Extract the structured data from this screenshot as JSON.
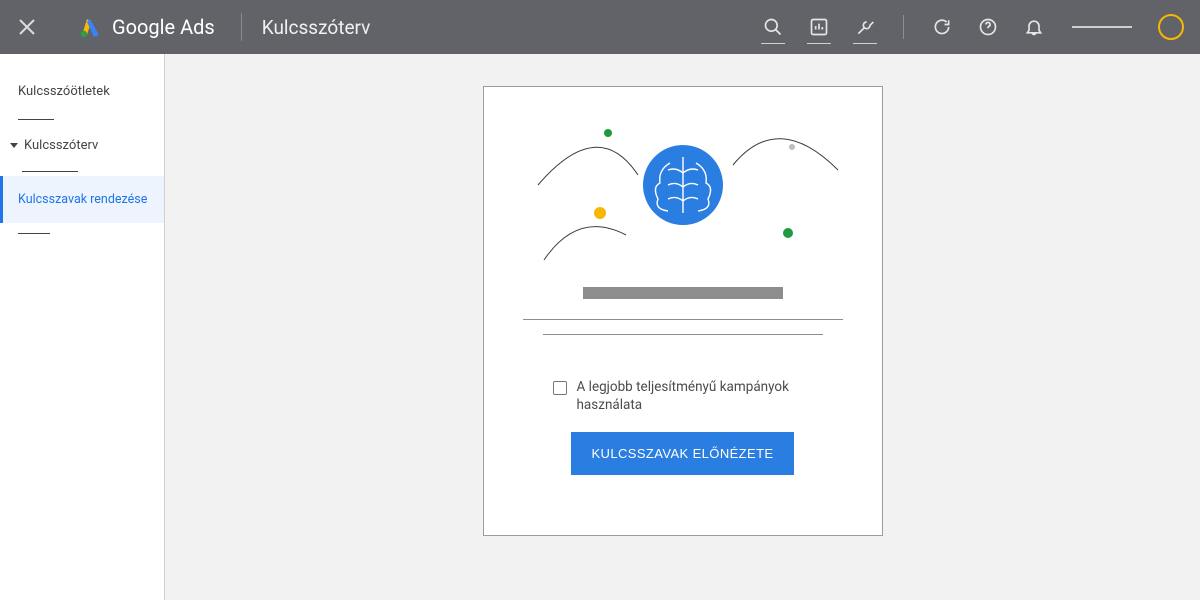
{
  "header": {
    "product": "Google Ads",
    "title": "Kulcsszóterv"
  },
  "sidebar": {
    "ideas": "Kulcsszóötletek",
    "plan": "Kulcsszóterv",
    "organize": "Kulcsszavak rendezése"
  },
  "card": {
    "checkbox_label": "A legjobb teljesítményű kampányok használata",
    "cta": "KULCSSZAVAK ELŐNÉZETE"
  },
  "colors": {
    "accent": "#2a7de1",
    "header_bg": "#616368"
  }
}
